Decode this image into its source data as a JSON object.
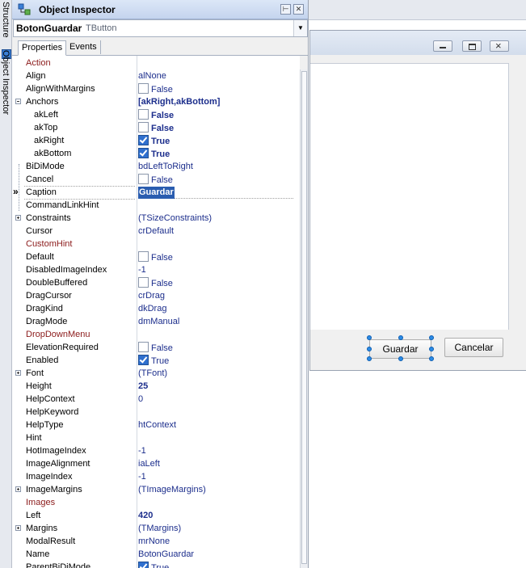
{
  "side_tabs": [
    "Structure",
    "Object Inspector"
  ],
  "inspector": {
    "title": "Object Inspector",
    "component_name": "BotonGuardar",
    "component_type": "TButton",
    "tabs": [
      "Properties",
      "Events"
    ]
  },
  "properties": [
    {
      "name": "Action",
      "value": "",
      "kind": "event"
    },
    {
      "name": "Align",
      "value": "alNone"
    },
    {
      "name": "AlignWithMargins",
      "value": "False",
      "checkbox": "off"
    },
    {
      "name": "Anchors",
      "value": "[akRight,akBottom]",
      "bold": true,
      "expander": "minus"
    },
    {
      "name": "akLeft",
      "value": "False",
      "checkbox": "off",
      "bold": true,
      "sub": true
    },
    {
      "name": "akTop",
      "value": "False",
      "checkbox": "off",
      "bold": true,
      "sub": true
    },
    {
      "name": "akRight",
      "value": "True",
      "checkbox": "on",
      "bold": true,
      "sub": true
    },
    {
      "name": "akBottom",
      "value": "True",
      "checkbox": "on",
      "bold": true,
      "sub": true
    },
    {
      "name": "BiDiMode",
      "value": "bdLeftToRight"
    },
    {
      "name": "Cancel",
      "value": "False",
      "checkbox": "off"
    },
    {
      "name": "Caption",
      "value": "Guardar",
      "selected": true,
      "marker": "»"
    },
    {
      "name": "CommandLinkHint",
      "value": ""
    },
    {
      "name": "Constraints",
      "value": "(TSizeConstraints)",
      "expander": "plus"
    },
    {
      "name": "Cursor",
      "value": "crDefault"
    },
    {
      "name": "CustomHint",
      "value": "",
      "kind": "event"
    },
    {
      "name": "Default",
      "value": "False",
      "checkbox": "off"
    },
    {
      "name": "DisabledImageIndex",
      "value": "-1"
    },
    {
      "name": "DoubleBuffered",
      "value": "False",
      "checkbox": "off"
    },
    {
      "name": "DragCursor",
      "value": "crDrag"
    },
    {
      "name": "DragKind",
      "value": "dkDrag"
    },
    {
      "name": "DragMode",
      "value": "dmManual"
    },
    {
      "name": "DropDownMenu",
      "value": "",
      "kind": "event"
    },
    {
      "name": "ElevationRequired",
      "value": "False",
      "checkbox": "off"
    },
    {
      "name": "Enabled",
      "value": "True",
      "checkbox": "on"
    },
    {
      "name": "Font",
      "value": "(TFont)",
      "expander": "plus"
    },
    {
      "name": "Height",
      "value": "25",
      "bold": true
    },
    {
      "name": "HelpContext",
      "value": "0"
    },
    {
      "name": "HelpKeyword",
      "value": ""
    },
    {
      "name": "HelpType",
      "value": "htContext"
    },
    {
      "name": "Hint",
      "value": ""
    },
    {
      "name": "HotImageIndex",
      "value": "-1"
    },
    {
      "name": "ImageAlignment",
      "value": "iaLeft"
    },
    {
      "name": "ImageIndex",
      "value": "-1"
    },
    {
      "name": "ImageMargins",
      "value": "(TImageMargins)",
      "expander": "plus"
    },
    {
      "name": "Images",
      "value": "",
      "kind": "event"
    },
    {
      "name": "Left",
      "value": "420",
      "bold": true
    },
    {
      "name": "Margins",
      "value": "(TMargins)",
      "expander": "plus"
    },
    {
      "name": "ModalResult",
      "value": "mrNone"
    },
    {
      "name": "Name",
      "value": "BotonGuardar"
    },
    {
      "name": "ParentBiDiMode",
      "value": "True",
      "checkbox": "on"
    }
  ],
  "designer": {
    "guardar_label": "Guardar",
    "cancelar_label": "Cancelar"
  },
  "colors": {
    "value_text": "#1c2e8c",
    "event_text": "#8b1a1a",
    "selection": "#2a5db0",
    "handle": "#2b8be6"
  }
}
